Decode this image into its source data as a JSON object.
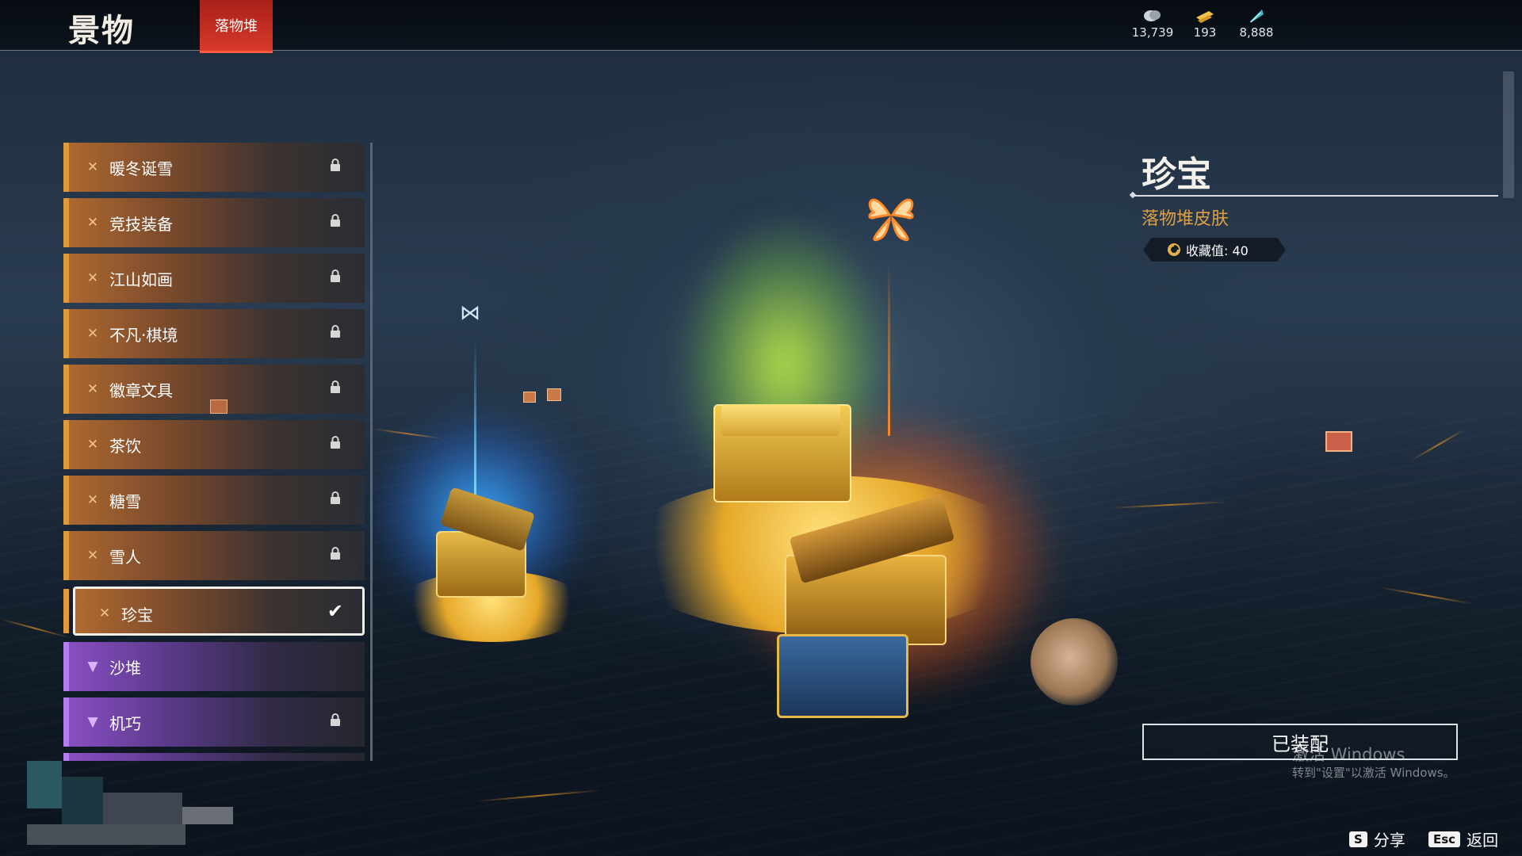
{
  "header": {
    "title": "景物",
    "active_tab": "落物堆"
  },
  "currencies": [
    {
      "icon": "silver-coin-icon",
      "value": "13,739"
    },
    {
      "icon": "gold-ticket-icon",
      "value": "193"
    },
    {
      "icon": "feather-icon",
      "value": "8,888"
    }
  ],
  "list": {
    "items": [
      {
        "label": "暖冬诞雪",
        "rarity": "orange",
        "locked": true
      },
      {
        "label": "竞技装备",
        "rarity": "orange",
        "locked": true
      },
      {
        "label": "江山如画",
        "rarity": "orange",
        "locked": true
      },
      {
        "label": "不凡·棋境",
        "rarity": "orange",
        "locked": true
      },
      {
        "label": "徽章文具",
        "rarity": "orange",
        "locked": true
      },
      {
        "label": "茶饮",
        "rarity": "orange",
        "locked": true
      },
      {
        "label": "糖雪",
        "rarity": "orange",
        "locked": true
      },
      {
        "label": "雪人",
        "rarity": "orange",
        "locked": true
      },
      {
        "label": "珍宝",
        "rarity": "orange",
        "selected": true,
        "equipped": true
      },
      {
        "label": "沙堆",
        "rarity": "purple",
        "locked": false
      },
      {
        "label": "机巧",
        "rarity": "purple",
        "locked": true
      }
    ]
  },
  "detail": {
    "name": "珍宝",
    "type": "落物堆皮肤",
    "collection_label": "收藏值: 40",
    "equip_button": "已装配"
  },
  "watermark": {
    "line1": "激活 Windows",
    "line2": "转到\"设置\"以激活 Windows。"
  },
  "key_hints": [
    {
      "key": "S",
      "label": "分享"
    },
    {
      "key": "Esc",
      "label": "返回"
    }
  ],
  "colors": {
    "accent_red": "#d8392a",
    "rarity_orange": "#e09a3c",
    "rarity_purple": "#b57cf0",
    "detail_subtitle": "#e0a040"
  }
}
